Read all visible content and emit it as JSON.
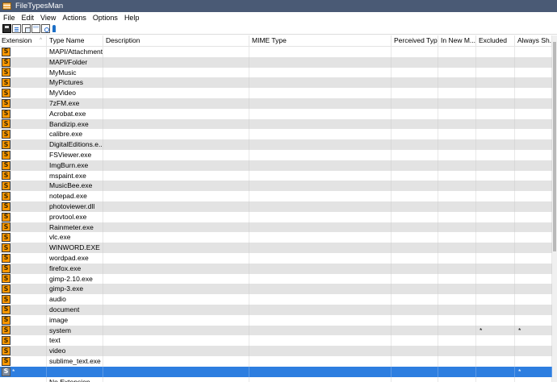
{
  "window": {
    "title": "FileTypesMan"
  },
  "menu": [
    "File",
    "Edit",
    "View",
    "Actions",
    "Options",
    "Help"
  ],
  "toolbar": [
    {
      "name": "save-icon"
    },
    {
      "name": "properties-icon"
    },
    {
      "name": "copy-icon"
    },
    {
      "name": "html-report-icon"
    },
    {
      "name": "find-icon"
    },
    {
      "name": "about-icon"
    }
  ],
  "columns": [
    "Extension",
    "Type Name",
    "Description",
    "MIME Type",
    "Perceived Type",
    "In New M...",
    "Excluded",
    "Always Sh..."
  ],
  "sort_indicator": "^",
  "rows": [
    {
      "ext": "",
      "type": "MAPI/Attachment",
      "excluded": "",
      "always": ""
    },
    {
      "ext": "",
      "type": "MAPI/Folder",
      "excluded": "",
      "always": ""
    },
    {
      "ext": "",
      "type": "MyMusic",
      "excluded": "",
      "always": ""
    },
    {
      "ext": "",
      "type": "MyPictures",
      "excluded": "",
      "always": ""
    },
    {
      "ext": "",
      "type": "MyVideo",
      "excluded": "",
      "always": ""
    },
    {
      "ext": "",
      "type": "7zFM.exe",
      "excluded": "",
      "always": ""
    },
    {
      "ext": "",
      "type": "Acrobat.exe",
      "excluded": "",
      "always": ""
    },
    {
      "ext": "",
      "type": "Bandizip.exe",
      "excluded": "",
      "always": ""
    },
    {
      "ext": "",
      "type": "calibre.exe",
      "excluded": "",
      "always": ""
    },
    {
      "ext": "",
      "type": "DigitalEditions.e...",
      "excluded": "",
      "always": ""
    },
    {
      "ext": "",
      "type": "FSViewer.exe",
      "excluded": "",
      "always": ""
    },
    {
      "ext": "",
      "type": "ImgBurn.exe",
      "excluded": "",
      "always": ""
    },
    {
      "ext": "",
      "type": "mspaint.exe",
      "excluded": "",
      "always": ""
    },
    {
      "ext": "",
      "type": "MusicBee.exe",
      "excluded": "",
      "always": ""
    },
    {
      "ext": "",
      "type": "notepad.exe",
      "excluded": "",
      "always": ""
    },
    {
      "ext": "",
      "type": "photoviewer.dll",
      "excluded": "",
      "always": ""
    },
    {
      "ext": "",
      "type": "provtool.exe",
      "excluded": "",
      "always": ""
    },
    {
      "ext": "",
      "type": "Rainmeter.exe",
      "excluded": "",
      "always": ""
    },
    {
      "ext": "",
      "type": "vlc.exe",
      "excluded": "",
      "always": ""
    },
    {
      "ext": "",
      "type": "WINWORD.EXE",
      "excluded": "",
      "always": ""
    },
    {
      "ext": "",
      "type": "wordpad.exe",
      "excluded": "",
      "always": ""
    },
    {
      "ext": "",
      "type": "firefox.exe",
      "excluded": "",
      "always": ""
    },
    {
      "ext": "",
      "type": "gimp-2.10.exe",
      "excluded": "",
      "always": ""
    },
    {
      "ext": "",
      "type": "gimp-3.exe",
      "excluded": "",
      "always": ""
    },
    {
      "ext": "",
      "type": "audio",
      "excluded": "",
      "always": ""
    },
    {
      "ext": "",
      "type": "document",
      "excluded": "",
      "always": ""
    },
    {
      "ext": "",
      "type": "image",
      "excluded": "",
      "always": ""
    },
    {
      "ext": "",
      "type": "system",
      "excluded": "*",
      "always": "*"
    },
    {
      "ext": "",
      "type": "text",
      "excluded": "",
      "always": ""
    },
    {
      "ext": "",
      "type": "video",
      "excluded": "",
      "always": ""
    },
    {
      "ext": "",
      "type": "sublime_text.exe",
      "excluded": "",
      "always": ""
    },
    {
      "ext": "*",
      "type": "",
      "excluded": "",
      "always": "*",
      "selected": true,
      "icon": "gray"
    },
    {
      "ext": ".",
      "type": "No Extension",
      "excluded": "",
      "always": "",
      "icon": "none"
    }
  ],
  "colors": {
    "titlebar": "#4a5a75",
    "row_alt": "#e3e3e3",
    "selection": "#2d7ee0",
    "icon": "#ff9800"
  },
  "icon_glyph": "S"
}
